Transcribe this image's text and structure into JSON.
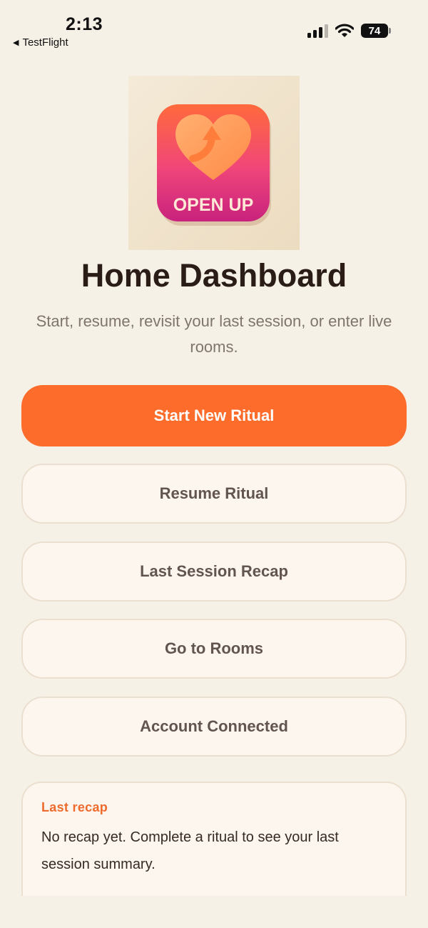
{
  "status_bar": {
    "time": "2:13",
    "back_label": "TestFlight",
    "battery_level": "74"
  },
  "logo": {
    "text": "OPEN UP"
  },
  "header": {
    "title": "Home Dashboard",
    "subtitle": "Start, resume, revisit your last session, or enter live rooms."
  },
  "buttons": {
    "start": "Start New Ritual",
    "resume": "Resume Ritual",
    "recap": "Last Session Recap",
    "rooms": "Go to Rooms",
    "account": "Account Connected"
  },
  "recap_card": {
    "title": "Last recap",
    "text": "No recap yet. Complete a ritual to see your last session summary."
  },
  "colors": {
    "background": "#f6f1e7",
    "accent": "#fe6c2b",
    "card": "#fdf6ee",
    "border": "#ebdfd0"
  }
}
